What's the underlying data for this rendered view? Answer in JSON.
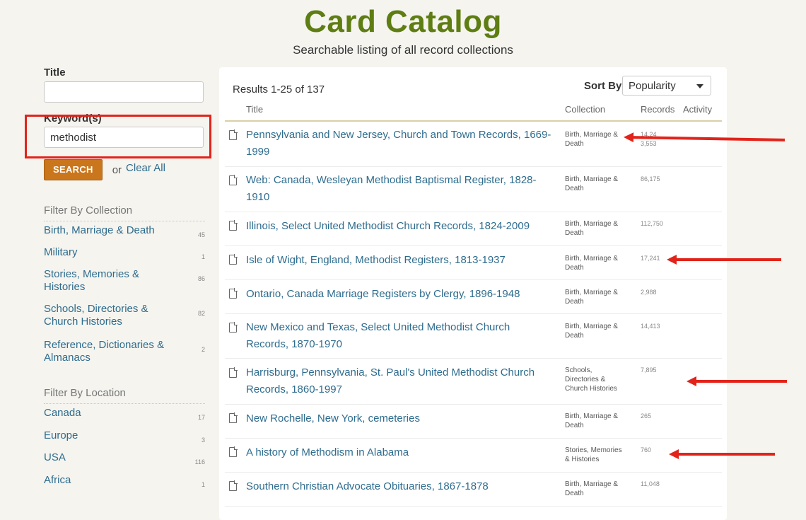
{
  "header": {
    "title": "Card Catalog",
    "subtitle": "Searchable listing of all record collections"
  },
  "search": {
    "title_label": "Title",
    "title_value": "",
    "keyword_label": "Keyword(s)",
    "keyword_value": "methodist",
    "search_label": "SEARCH",
    "or_text": "or",
    "clear_label": "Clear All"
  },
  "filters": {
    "collection_heading": "Filter By Collection",
    "collection": [
      {
        "label": "Birth, Marriage & Death",
        "count": "45"
      },
      {
        "label": "Military",
        "count": "1"
      },
      {
        "label": "Stories, Memories & Histories",
        "count": "86"
      },
      {
        "label": "Schools, Directories & Church Histories",
        "count": "82"
      },
      {
        "label": "Reference, Dictionaries & Almanacs",
        "count": "2"
      }
    ],
    "location_heading": "Filter By Location",
    "location": [
      {
        "label": "Canada",
        "count": "17"
      },
      {
        "label": "Europe",
        "count": "3"
      },
      {
        "label": "USA",
        "count": "116"
      },
      {
        "label": "Africa",
        "count": "1"
      }
    ]
  },
  "results": {
    "count_text": "Results 1-25 of 137",
    "sort_label": "Sort By",
    "sort_value": "Popularity",
    "columns": {
      "title": "Title",
      "collection": "Collection",
      "records": "Records",
      "activity": "Activity"
    },
    "rows": [
      {
        "title": "Pennsylvania and New Jersey, Church and Town Records, 1669-1999",
        "collection": "Birth, Marriage & Death",
        "records": "14,243,553"
      },
      {
        "title": "Web: Canada, Wesleyan Methodist Baptismal Register, 1828-1910",
        "collection": "Birth, Marriage & Death",
        "records": "86,175"
      },
      {
        "title": "Illinois, Select United Methodist Church Records, 1824-2009",
        "collection": "Birth, Marriage & Death",
        "records": "112,750"
      },
      {
        "title": "Isle of Wight, England, Methodist Registers, 1813-1937",
        "collection": "Birth, Marriage & Death",
        "records": "17,241"
      },
      {
        "title": "Ontario, Canada Marriage Registers by Clergy, 1896-1948",
        "collection": "Birth, Marriage & Death",
        "records": "2,988"
      },
      {
        "title": "New Mexico and Texas, Select United Methodist Church Records, 1870-1970",
        "collection": "Birth, Marriage & Death",
        "records": "14,413"
      },
      {
        "title": "Harrisburg, Pennsylvania, St. Paul's United Methodist Church Records, 1860-1997",
        "collection": "Schools, Directories & Church Histories",
        "records": "7,895"
      },
      {
        "title": "New Rochelle, New York, cemeteries",
        "collection": "Birth, Marriage & Death",
        "records": "265"
      },
      {
        "title": "A history of Methodism in Alabama",
        "collection": "Stories, Memories & Histories",
        "records": "760"
      },
      {
        "title": "Southern Christian Advocate Obituaries, 1867-1878",
        "collection": "Birth, Marriage & Death",
        "records": "11,048"
      }
    ]
  },
  "annotations": {
    "color": "#e2231a"
  }
}
